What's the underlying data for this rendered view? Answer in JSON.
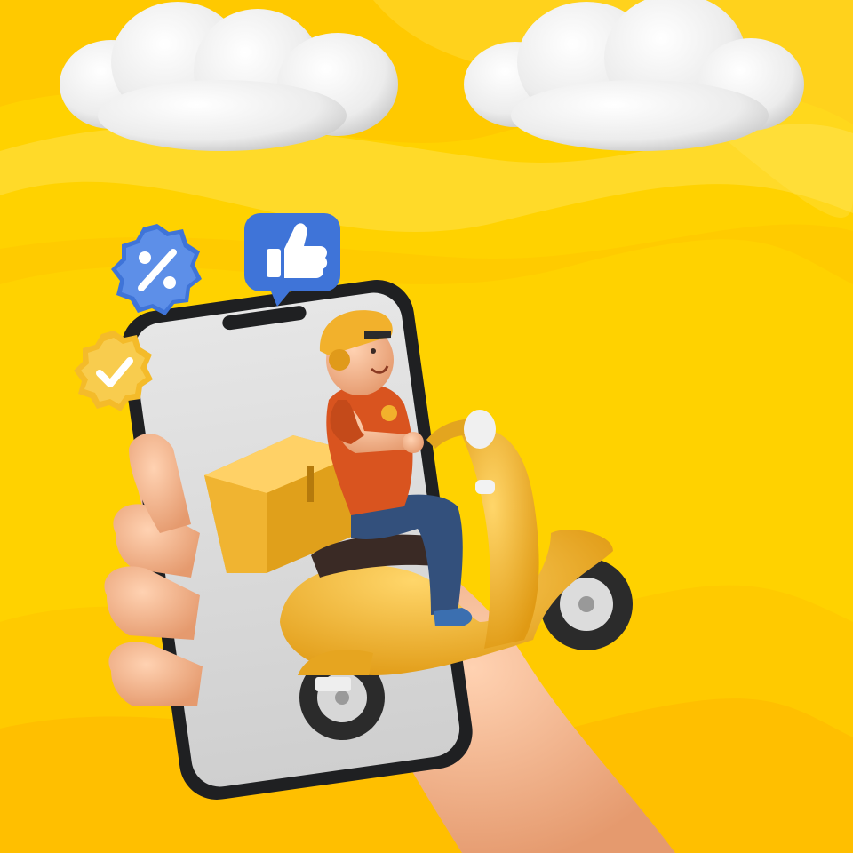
{
  "scene": {
    "description_icons": [
      "cloud-icon",
      "percent-badge-icon",
      "thumbs-up-icon",
      "verified-check-icon",
      "delivery-scooter-icon",
      "smartphone-icon",
      "hand-icon"
    ],
    "colors": {
      "background": "#ffd200",
      "background_wave_light": "#ffe54a",
      "background_wave_dark": "#ffbf00",
      "cloud": "#f4f4f4",
      "phone_frame": "#1f2022",
      "phone_screen": "#dcdcdc",
      "badge_blue": "#3f74d8",
      "badge_gold": "#f4bb2a",
      "scooter": "#f3b532",
      "shirt": "#d9541f",
      "jeans": "#33507c",
      "helmet": "#f2b12c",
      "skin": "#f6b98f"
    }
  }
}
